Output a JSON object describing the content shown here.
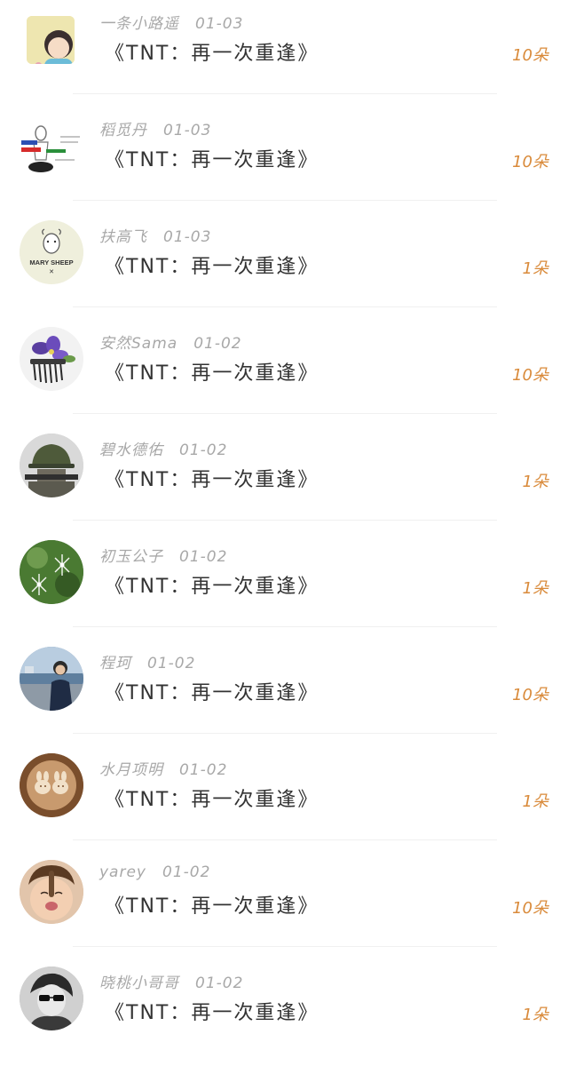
{
  "gifts": [
    {
      "user": "一条小路遥",
      "date": "01-03",
      "item": "《TNT：再一次重逢》",
      "amount": "10朵",
      "avatar": "anime-girl-avatar"
    },
    {
      "user": "稻觅丹",
      "date": "01-03",
      "item": "《TNT：再一次重逢》",
      "amount": "10朵",
      "avatar": "sketch-figure-avatar"
    },
    {
      "user": "扶高飞",
      "date": "01-03",
      "item": "《TNT：再一次重逢》",
      "amount": "1朵",
      "avatar": "mary-sheep-avatar"
    },
    {
      "user": "安然Sama",
      "date": "01-02",
      "item": "《TNT：再一次重逢》",
      "amount": "10朵",
      "avatar": "flower-hairpin-avatar"
    },
    {
      "user": "碧水德佑",
      "date": "01-02",
      "item": "《TNT：再一次重逢》",
      "amount": "1朵",
      "avatar": "soldier-helmet-avatar"
    },
    {
      "user": "初玉公子",
      "date": "01-02",
      "item": "《TNT：再一次重逢》",
      "amount": "1朵",
      "avatar": "sparkle-green-avatar"
    },
    {
      "user": "程珂",
      "date": "01-02",
      "item": "《TNT：再一次重逢》",
      "amount": "10朵",
      "avatar": "man-harbor-avatar"
    },
    {
      "user": "水月项明",
      "date": "01-02",
      "item": "《TNT：再一次重逢》",
      "amount": "1朵",
      "avatar": "latte-art-avatar"
    },
    {
      "user": "yarey",
      "date": "01-02",
      "item": "《TNT：再一次重逢》",
      "amount": "10朵",
      "avatar": "child-face-avatar"
    },
    {
      "user": "晓桃小哥哥",
      "date": "01-02",
      "item": "《TNT：再一次重逢》",
      "amount": "1朵",
      "avatar": "sunglasses-portrait-avatar"
    }
  ],
  "colors": {
    "amount": "#d98a3a",
    "meta": "#a8a8a8",
    "title": "#333333"
  }
}
